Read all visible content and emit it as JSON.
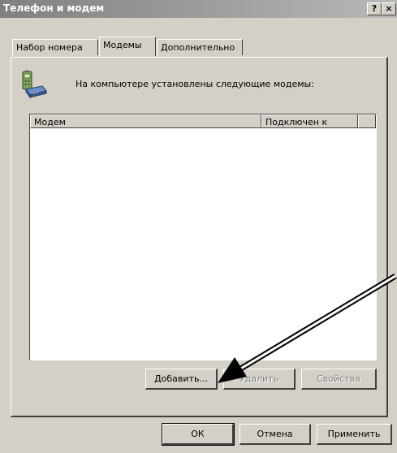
{
  "window": {
    "title": "Телефон и модем",
    "help_label": "?",
    "close_label": "×"
  },
  "tabs": [
    {
      "label": "Набор номера",
      "active": false
    },
    {
      "label": "Модемы",
      "active": true
    },
    {
      "label": "Дополнительно",
      "active": false
    }
  ],
  "modems_tab": {
    "description": "На компьютере установлены следующие модемы:",
    "columns": [
      "Модем",
      "Подключен к",
      ""
    ],
    "rows": [],
    "buttons": {
      "add": "Добавить...",
      "remove": "Удалить",
      "properties": "Свойства"
    }
  },
  "footer": {
    "ok": "ОК",
    "cancel": "Отмена",
    "apply": "Применить"
  },
  "colors": {
    "face": "#d4d0c8",
    "shadow": "#404040",
    "highlight": "#ffffff",
    "title_start": "#808080",
    "title_end": "#b8b8b8"
  },
  "icons": {
    "modem": "phone-modem-icon",
    "pointer": "arrow-annotation"
  }
}
